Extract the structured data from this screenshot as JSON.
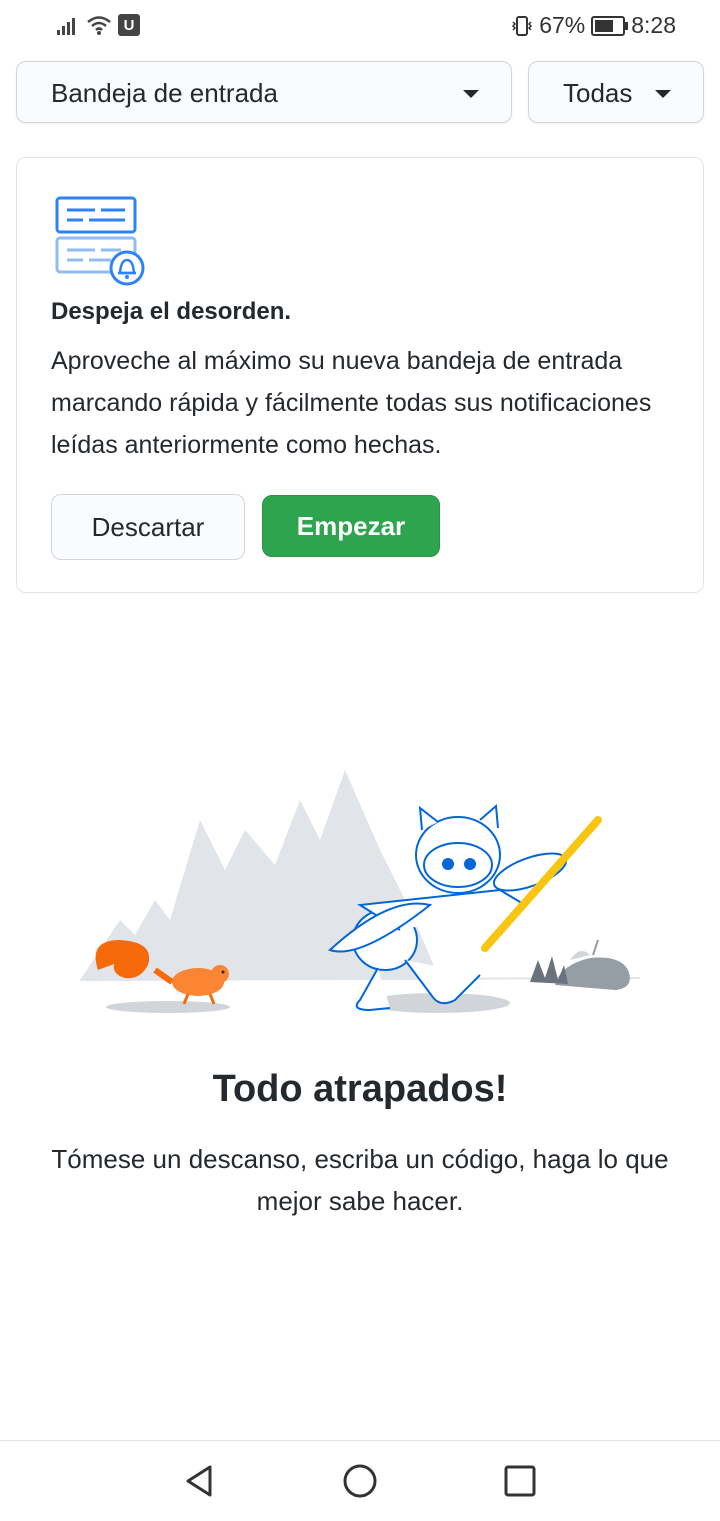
{
  "status_bar": {
    "battery_percent": "67%",
    "battery_level": 0.67,
    "time": "8:28",
    "carrier_badge": "U",
    "icons": [
      "signal-icon",
      "wifi-icon",
      "vibrate-icon",
      "battery-icon"
    ]
  },
  "filters": {
    "inbox_label": "Bandeja de entrada",
    "filter_label": "Todas"
  },
  "promo": {
    "icon": "inbox-bell-icon",
    "title": "Despeja el desorden.",
    "body": "Aproveche al máximo su nueva bandeja de entrada marcando rápida y fácilmente todas sus notificaciones leídas anteriormente como hechas.",
    "dismiss_label": "Descartar",
    "start_label": "Empezar"
  },
  "empty_state": {
    "illustration": "octocat-sweeping-illustration",
    "title": "Todo atrapados!",
    "text": "Tómese un descanso, escriba un código, haga lo que mejor sabe hacer."
  },
  "nav_bar": {
    "icons": [
      "back-icon",
      "home-icon",
      "recents-icon"
    ]
  },
  "colors": {
    "primary_button": "#2ea44f",
    "icon_blue": "#2f81f7",
    "squirrel_orange": "#f66a0a"
  }
}
